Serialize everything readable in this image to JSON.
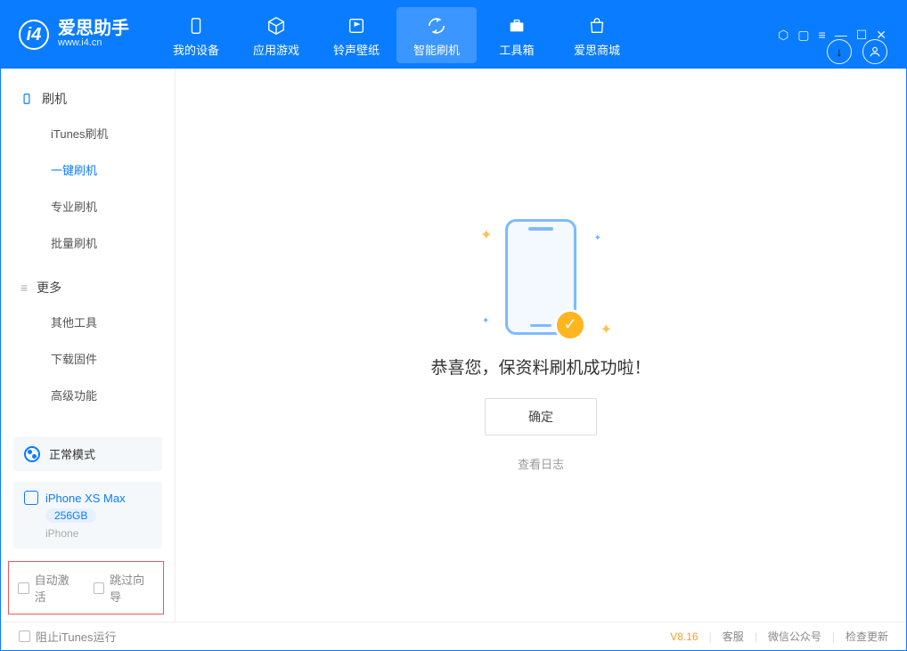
{
  "app": {
    "name_cn": "爱思助手",
    "name_en": "www.i4.cn"
  },
  "nav": {
    "items": [
      {
        "label": "我的设备"
      },
      {
        "label": "应用游戏"
      },
      {
        "label": "铃声壁纸"
      },
      {
        "label": "智能刷机"
      },
      {
        "label": "工具箱"
      },
      {
        "label": "爱思商城"
      }
    ]
  },
  "sidebar": {
    "section1": "刷机",
    "items1": [
      {
        "label": "iTunes刷机"
      },
      {
        "label": "一键刷机"
      },
      {
        "label": "专业刷机"
      },
      {
        "label": "批量刷机"
      }
    ],
    "section2": "更多",
    "items2": [
      {
        "label": "其他工具"
      },
      {
        "label": "下载固件"
      },
      {
        "label": "高级功能"
      }
    ],
    "mode": "正常模式",
    "device": {
      "name": "iPhone XS Max",
      "storage": "256GB",
      "type": "iPhone"
    },
    "opts": {
      "auto_activate": "自动激活",
      "skip_guide": "跳过向导"
    }
  },
  "main": {
    "success_text": "恭喜您，保资料刷机成功啦！",
    "ok": "确定",
    "view_log": "查看日志"
  },
  "status": {
    "block_itunes": "阻止iTunes运行",
    "version": "V8.16",
    "links": [
      "客服",
      "微信公众号",
      "检查更新"
    ]
  }
}
